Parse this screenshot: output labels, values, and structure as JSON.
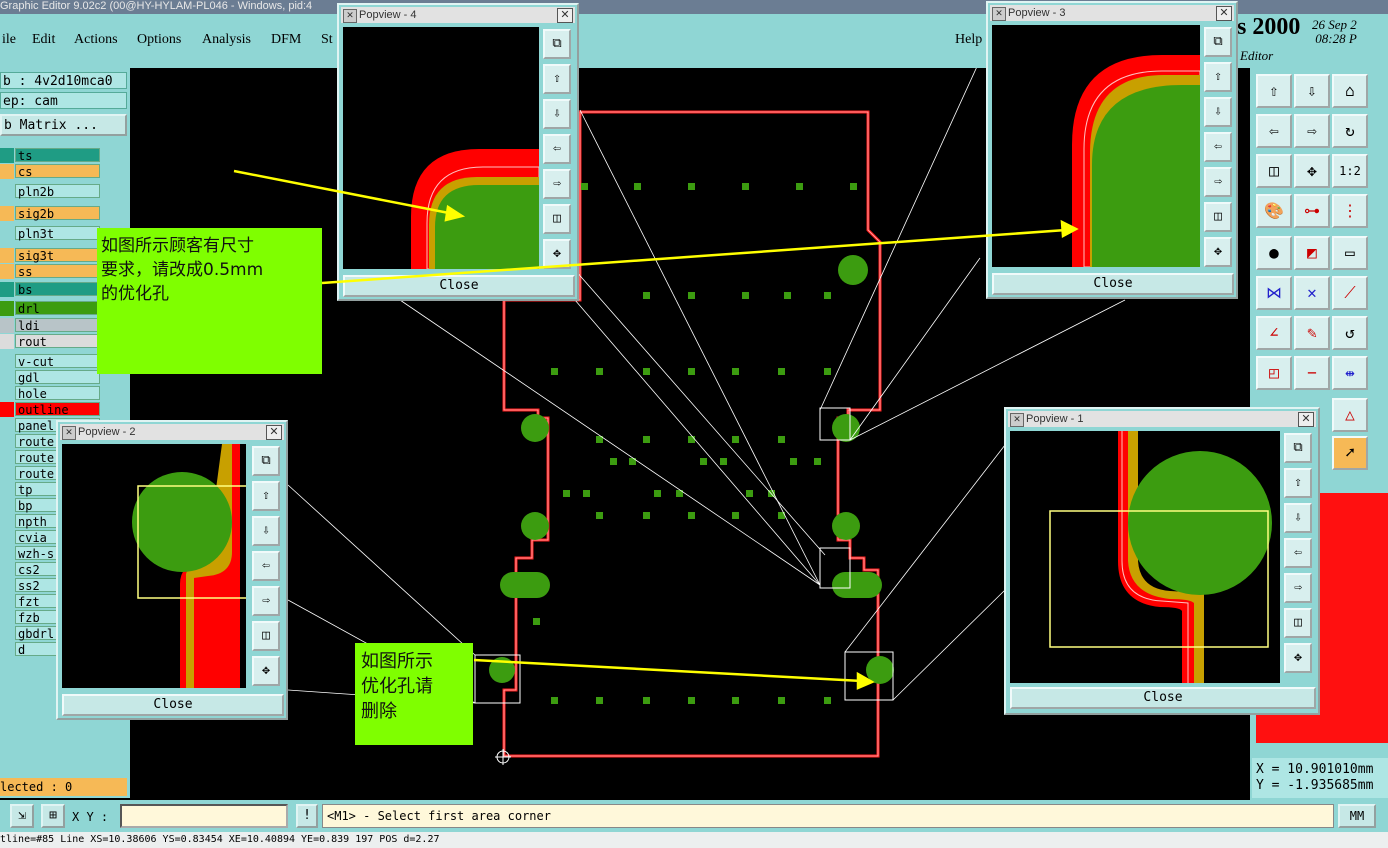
{
  "window": {
    "title": "Graphic Editor 9.02c2 (00@HY-HYLAM-PL046 - Windows, pid:4"
  },
  "menu": [
    "ile",
    "Edit",
    "Actions",
    "Options",
    "Analysis",
    "DFM",
    "St",
    "Help"
  ],
  "brand": {
    "text": "s 2000",
    "date": "26 Sep 2",
    "time": "08:28 P",
    "subtitle": "Editor"
  },
  "job": {
    "job": "b : 4v2d10mca0",
    "step": "ep: cam",
    "matrix_button": "b Matrix ..."
  },
  "layers": [
    {
      "name": "ts",
      "color": "#1f9c84"
    },
    {
      "name": "cs",
      "color": "#f6b956"
    },
    {
      "name": "pln2b",
      "color": "#aee6e4"
    },
    {
      "name": "sig2b",
      "color": "#f6b956"
    },
    {
      "name": "pln3t",
      "color": "#aee6e4"
    },
    {
      "name": "sig3t",
      "color": "#f6b956"
    },
    {
      "name": "ss",
      "color": "#f6b956"
    },
    {
      "name": "bs",
      "color": "#1f9c84"
    },
    {
      "name": "drl",
      "color": "#3c9c10"
    },
    {
      "name": "ldi",
      "color": "#b8c4c8"
    },
    {
      "name": "rout",
      "color": "#dcdcdc"
    },
    {
      "name": "v-cut",
      "color": "#aee6e4"
    },
    {
      "name": "gdl",
      "color": "#aee6e4"
    },
    {
      "name": "hole",
      "color": "#aee6e4"
    },
    {
      "name": "outline",
      "color": "#ff0000"
    },
    {
      "name": "panel",
      "color": "#aee6e4"
    },
    {
      "name": "route",
      "color": "#aee6e4"
    },
    {
      "name": "route",
      "color": "#aee6e4"
    },
    {
      "name": "route",
      "color": "#aee6e4"
    },
    {
      "name": "tp",
      "color": "#aee6e4"
    },
    {
      "name": "bp",
      "color": "#aee6e4"
    },
    {
      "name": "npth",
      "color": "#aee6e4"
    },
    {
      "name": "cvia",
      "color": "#aee6e4"
    },
    {
      "name": "wzh-s",
      "color": "#aee6e4"
    },
    {
      "name": "cs2",
      "color": "#aee6e4"
    },
    {
      "name": "ss2",
      "color": "#aee6e4"
    },
    {
      "name": "fzt",
      "color": "#aee6e4"
    },
    {
      "name": "fzb",
      "color": "#aee6e4"
    },
    {
      "name": "gbdrl",
      "color": "#aee6e4"
    },
    {
      "name": "d",
      "color": "#aee6e4"
    }
  ],
  "selected": "lected : 0",
  "input": {
    "xy_label": "X Y :",
    "xy_value": "",
    "prompt": "<M1> - Select first area corner",
    "units": "MM"
  },
  "coordinates": {
    "x": "X = 10.901010mm",
    "y": "Y = -1.935685mm"
  },
  "status_line": "tline=#85 Line XS=10.38606 YS=0.83454 XE=10.40894 YE=0.839 197 POS d=2.27",
  "popviews": [
    {
      "title": "Popview - 4",
      "close": "Close"
    },
    {
      "title": "Popview - 3",
      "close": "Close"
    },
    {
      "title": "Popview - 2",
      "close": "Close"
    },
    {
      "title": "Popview - 1",
      "close": "Close"
    }
  ],
  "notes": {
    "note1": [
      "如图所示顾客有尺寸",
      "要求，请改成0.5mm",
      "的优化孔"
    ],
    "note2": [
      "如图所示",
      "优化孔请",
      "删除"
    ]
  },
  "colors": {
    "board_outline": "#ff0000",
    "pad": "#3c9c10",
    "annotation_arrow": "#ffff00",
    "note_bg": "#7fff00"
  }
}
